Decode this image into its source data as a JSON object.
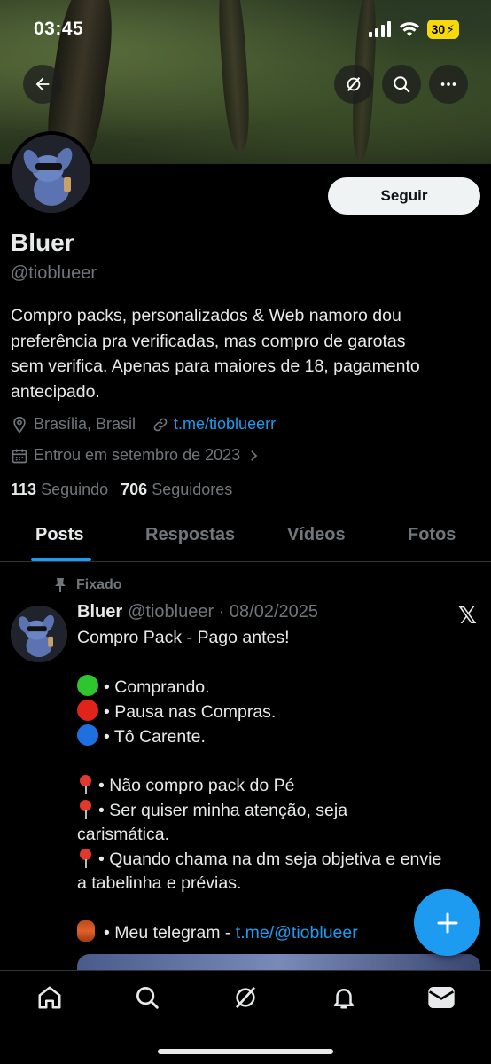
{
  "status_bar": {
    "time": "03:45",
    "battery": "30"
  },
  "header": {
    "back_icon": "arrow-left-icon",
    "grok_icon": "grok-icon",
    "search_icon": "search-icon",
    "more_icon": "more-horizontal-icon"
  },
  "profile": {
    "follow_label": "Seguir",
    "name": "Bluer",
    "handle": "@tioblueer",
    "bio_lines": [
      "Compro packs, personalizados & Web namoro dou",
      "preferência pra verificadas, mas compro de garotas",
      "sem verifica. Apenas para maiores de 18, pagamento",
      "antecipado."
    ],
    "location": "Brasília, Brasil",
    "website": "t.me/tioblueerr",
    "joined": "Entrou em setembro de 2023",
    "following_count": "113",
    "following_label": "Seguindo",
    "followers_count": "706",
    "followers_label": "Seguidores"
  },
  "tabs": [
    {
      "label": "Posts",
      "active": true
    },
    {
      "label": "Respostas",
      "active": false
    },
    {
      "label": "Vídeos",
      "active": false
    },
    {
      "label": "Fotos",
      "active": false
    }
  ],
  "pinned_post": {
    "pinned_label": "Fixado",
    "author": "Bluer",
    "handle_date": "@tioblueer · 08/02/2025",
    "lines": {
      "l1": "Compro Pack - Pago antes!",
      "l2": "• Comprando.",
      "l3": "• Pausa nas Compras.",
      "l4": "• Tô Carente.",
      "l5": "• Não compro pack do Pé",
      "l6": "• Ser quiser minha atenção, seja",
      "l7": "carismática.",
      "l8": "• Quando chama na dm seja objetiva e envie",
      "l9": "a tabelinha e prévias.",
      "l10": "• Meu telegram - ",
      "l10_link": "t.me/@tioblueer"
    },
    "status_colors": {
      "green": "#2ec52e",
      "red": "#e0241c",
      "blue": "#1e6fe0"
    }
  },
  "bottom_nav": [
    "home-icon",
    "search-icon",
    "grok-icon",
    "notifications-icon",
    "messages-icon"
  ],
  "colors": {
    "accent": "#1d9bf0",
    "background": "#000000",
    "muted": "#71767b"
  }
}
